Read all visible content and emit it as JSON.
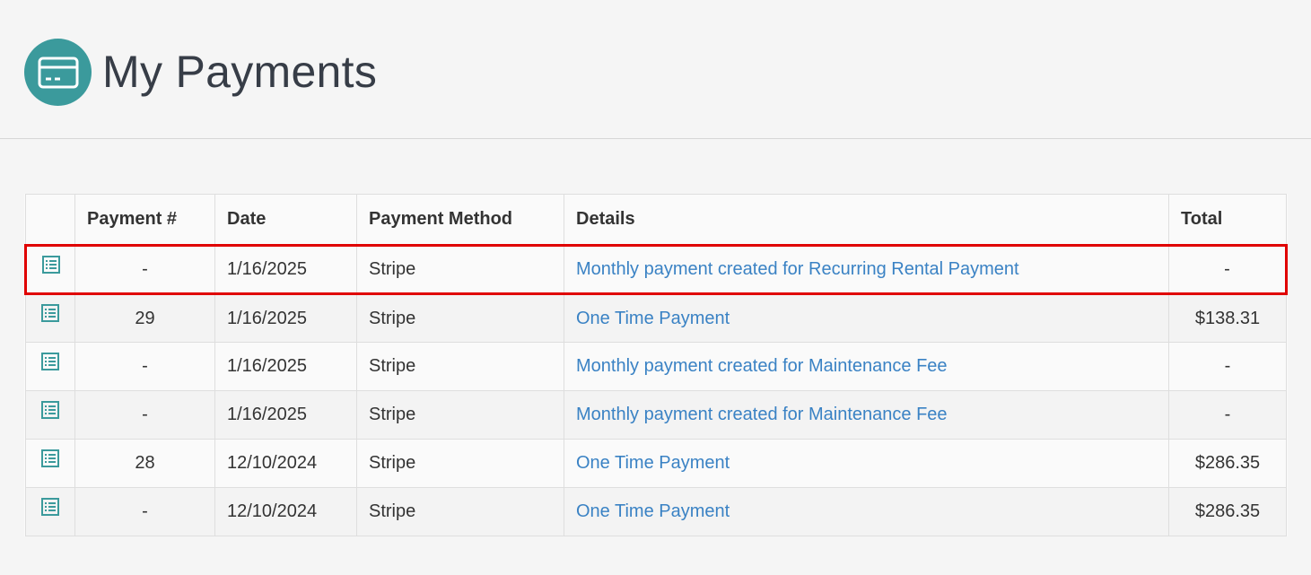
{
  "page": {
    "title": "My Payments",
    "icon": "credit-card-icon",
    "accent_color": "#3b9a9c",
    "link_color": "#3a82c4",
    "highlight_color": "#e00000"
  },
  "table": {
    "columns": [
      "",
      "Payment #",
      "Date",
      "Payment Method",
      "Details",
      "Total"
    ],
    "rows": [
      {
        "payment_no": "-",
        "date": "1/16/2025",
        "method": "Stripe",
        "details": "Monthly payment created for Recurring Rental Payment",
        "total": "-",
        "highlighted": true
      },
      {
        "payment_no": "29",
        "date": "1/16/2025",
        "method": "Stripe",
        "details": "One Time Payment",
        "total": "$138.31"
      },
      {
        "payment_no": "-",
        "date": "1/16/2025",
        "method": "Stripe",
        "details": "Monthly payment created for Maintenance Fee",
        "total": "-"
      },
      {
        "payment_no": "-",
        "date": "1/16/2025",
        "method": "Stripe",
        "details": "Monthly payment created for Maintenance Fee",
        "total": "-"
      },
      {
        "payment_no": "28",
        "date": "12/10/2024",
        "method": "Stripe",
        "details": "One Time Payment",
        "total": "$286.35"
      },
      {
        "payment_no": "-",
        "date": "12/10/2024",
        "method": "Stripe",
        "details": "One Time Payment",
        "total": "$286.35"
      }
    ]
  }
}
